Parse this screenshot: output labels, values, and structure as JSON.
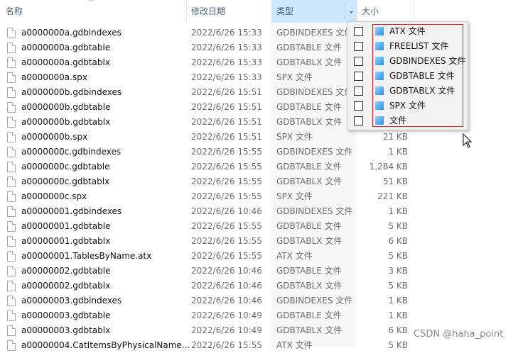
{
  "header": {
    "name": "名称",
    "modified": "修改日期",
    "type": "类型",
    "size": "大小",
    "filter_glyph": "⌄",
    "sort_glyph": "^"
  },
  "files": [
    {
      "name": "a0000000a.gdbindexes",
      "date": "2022/6/26 15:33",
      "type": "GDBINDEXES 文件",
      "size": ""
    },
    {
      "name": "a0000000a.gdbtable",
      "date": "2022/6/26 15:33",
      "type": "GDBTABLE 文件",
      "size": ""
    },
    {
      "name": "a0000000a.gdbtablx",
      "date": "2022/6/26 15:33",
      "type": "GDBTABLX 文件",
      "size": ""
    },
    {
      "name": "a0000000a.spx",
      "date": "2022/6/26 15:33",
      "type": "SPX 文件",
      "size": ""
    },
    {
      "name": "a0000000b.gdbindexes",
      "date": "2022/6/26 15:51",
      "type": "GDBINDEXES 文件",
      "size": ""
    },
    {
      "name": "a0000000b.gdbtable",
      "date": "2022/6/26 15:51",
      "type": "GDBTABLE 文件",
      "size": ""
    },
    {
      "name": "a0000000b.gdbtablx",
      "date": "2022/6/26 15:51",
      "type": "GDBTABLX 文件",
      "size": ""
    },
    {
      "name": "a0000000b.spx",
      "date": "2022/6/26 15:51",
      "type": "SPX 文件",
      "size": "21 KB"
    },
    {
      "name": "a0000000c.gdbindexes",
      "date": "2022/6/26 15:55",
      "type": "GDBINDEXES 文件",
      "size": "1 KB"
    },
    {
      "name": "a0000000c.gdbtable",
      "date": "2022/6/26 15:55",
      "type": "GDBTABLE 文件",
      "size": "1,284 KB"
    },
    {
      "name": "a0000000c.gdbtablx",
      "date": "2022/6/26 15:55",
      "type": "GDBTABLX 文件",
      "size": "51 KB"
    },
    {
      "name": "a0000000c.spx",
      "date": "2022/6/26 15:55",
      "type": "SPX 文件",
      "size": "221 KB"
    },
    {
      "name": "a00000001.gdbindexes",
      "date": "2022/6/26 10:46",
      "type": "GDBINDEXES 文件",
      "size": "1 KB"
    },
    {
      "name": "a00000001.gdbtable",
      "date": "2022/6/26 15:55",
      "type": "GDBTABLE 文件",
      "size": "5 KB"
    },
    {
      "name": "a00000001.gdbtablx",
      "date": "2022/6/26 15:55",
      "type": "GDBTABLX 文件",
      "size": "6 KB"
    },
    {
      "name": "a00000001.TablesByName.atx",
      "date": "2022/6/26 15:55",
      "type": "ATX 文件",
      "size": "5 KB"
    },
    {
      "name": "a00000002.gdbtable",
      "date": "2022/6/26 10:46",
      "type": "GDBTABLE 文件",
      "size": "3 KB"
    },
    {
      "name": "a00000002.gdbtablx",
      "date": "2022/6/26 10:46",
      "type": "GDBTABLX 文件",
      "size": "5 KB"
    },
    {
      "name": "a00000003.gdbindexes",
      "date": "2022/6/26 10:46",
      "type": "GDBINDEXES 文件",
      "size": "1 KB"
    },
    {
      "name": "a00000003.gdbtable",
      "date": "2022/6/26 10:49",
      "type": "GDBTABLE 文件",
      "size": "1 KB"
    },
    {
      "name": "a00000003.gdbtablx",
      "date": "2022/6/26 10:49",
      "type": "GDBTABLX 文件",
      "size": "6 KB"
    },
    {
      "name": "a00000004.CatItemsByPhysicalName...",
      "date": "2022/6/26 15:55",
      "type": "ATX 文件",
      "size": "5 KB"
    }
  ],
  "filter_menu": {
    "items": [
      {
        "label": "ATX 文件",
        "checked": false
      },
      {
        "label": "FREELIST 文件",
        "checked": false
      },
      {
        "label": "GDBINDEXES 文件",
        "checked": false
      },
      {
        "label": "GDBTABLE 文件",
        "checked": false
      },
      {
        "label": "GDBTABLX 文件",
        "checked": false
      },
      {
        "label": "SPX 文件",
        "checked": false
      },
      {
        "label": "文件",
        "checked": false
      }
    ]
  },
  "watermark": "CSDN @haha_point",
  "colors": {
    "header_highlight": "#cce8ff",
    "annotation_red": "#e02020",
    "header_text": "#4c607a"
  }
}
